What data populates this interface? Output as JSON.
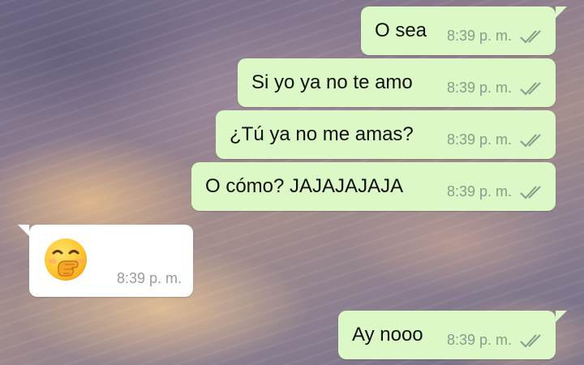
{
  "messages": [
    {
      "text": "O sea",
      "time": "8:39 p. m."
    },
    {
      "text": "Si yo ya no te amo",
      "time": "8:39 p. m."
    },
    {
      "text": "¿Tú ya no me amas?",
      "time": "8:39 p. m."
    },
    {
      "text": "O cómo? JAJAJAJAJA",
      "time": "8:39 p. m."
    },
    {
      "emoji": "hand-over-mouth-emoji",
      "time": "8:39 p. m."
    },
    {
      "text": "Ay nooo",
      "time": "8:39 p. m."
    }
  ],
  "colors": {
    "outgoing_bubble": "#dcf8c6",
    "incoming_bubble": "#ffffff",
    "read_ticks": "#8c9a8c"
  }
}
